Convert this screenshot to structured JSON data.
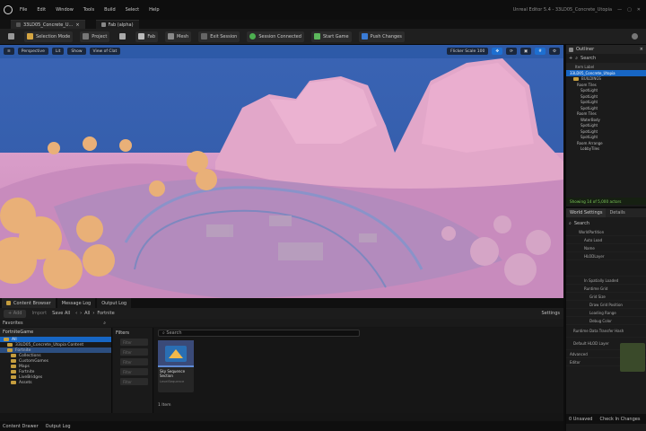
{
  "menubar": {
    "items": [
      "File",
      "Edit",
      "Window",
      "Tools",
      "Build",
      "Select",
      "Help"
    ],
    "right": [
      "Unreal Editor 5.4 - 33LD05_Concrete_Utopia"
    ]
  },
  "tabs": [
    {
      "label": "33LD05_Concrete_U..."
    },
    {
      "label": "Fab (alpha)"
    }
  ],
  "toolbar": {
    "mode": "Selection Mode",
    "items": [
      "Project",
      "Fab",
      "Mesh",
      "Exit Session",
      "Session Connected",
      "Start Game",
      "Push Changes"
    ]
  },
  "viewport": {
    "buttons": [
      "Perspective",
      "Lit",
      "Show",
      "View of Clat"
    ],
    "right": [
      "Flicker Scale 100"
    ]
  },
  "bottom": {
    "tabs": [
      "Content Browser",
      "Message Log",
      "Output Log"
    ],
    "add_label": "+ Add",
    "import_label": "Import",
    "save_all_label": "Save All",
    "path": [
      "All",
      "Fortnite"
    ],
    "settings_label": "Settings",
    "favorites_label": "Favorites",
    "project_label": "FortniteGame",
    "tree": [
      "33LD05_Concrete_Utopia Content",
      "Fortnite",
      "Collections",
      "CustomGames",
      "Maps",
      "Fortnite",
      "LiveBridges",
      "Assets"
    ],
    "filters_label": "Filters",
    "filters": [
      "Filter",
      "Filter",
      "Filter",
      "Filter",
      "Filter"
    ],
    "search_placeholder": "Search",
    "asset_name": "Sky Sequence Section",
    "asset_type": "LevelSequence",
    "count": "1 Item",
    "status_tabs": [
      "Content Drawer",
      "Output Log"
    ]
  },
  "outliner": {
    "title": "Outliner",
    "search": "Search",
    "column": "Item Label",
    "rows": [
      "33LD05_Concrete_Utopia",
      "BUILDINGS",
      "Room Tiles",
      "SpotLight",
      "SpotLight",
      "SpotLight",
      "SpotLight",
      "Room Tiles",
      "WaterBody",
      "SpotLight",
      "SpotLight",
      "SpotLight",
      "Room Arrange",
      "LobbyTiles"
    ],
    "status": "Showing 14 of 5,000 actors"
  },
  "details": {
    "tabs": [
      "World Settings",
      "Details"
    ],
    "search": "Search",
    "rows": [
      "WorldPartition",
      "Auto Load",
      "Name",
      "HLODLayer",
      "",
      "In Spatially Loaded",
      "Runtime Grid",
      "Grid Size",
      "Draw Grid Position",
      "Loading Range",
      "Debug Color",
      "Runtime Data Transfer Hash",
      "Default HLOD Layer",
      "Advanced",
      "Editor"
    ],
    "status": [
      "0 Unsaved",
      "Check In Changes"
    ]
  },
  "colors": {
    "accent": "#1766c4",
    "selected": "#1766c4"
  }
}
